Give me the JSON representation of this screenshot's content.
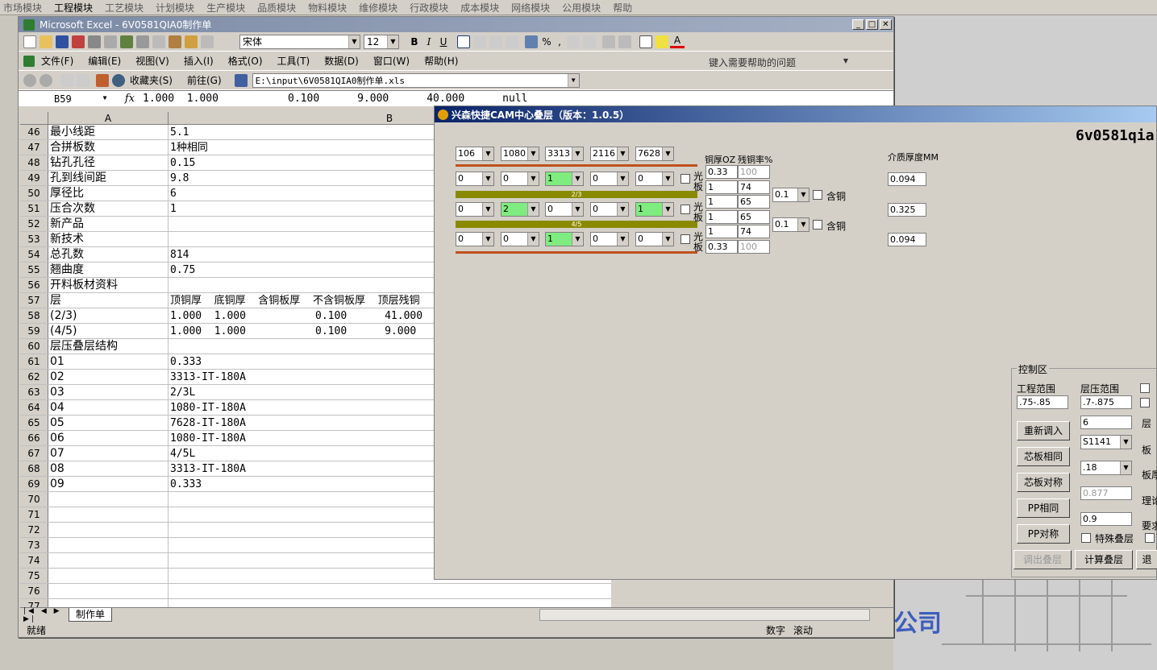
{
  "top_menu": [
    "市场模块",
    "工程模块",
    "工艺模块",
    "计划模块",
    "生产模块",
    "品质模块",
    "物料模块",
    "维修模块",
    "行政模块",
    "成本模块",
    "网络模块",
    "公用模块",
    "帮助"
  ],
  "excel": {
    "title": "Microsoft Excel - 6V0581QIA0制作单",
    "font_name": "宋体",
    "font_size": "12",
    "menu": [
      "文件(F)",
      "编辑(E)",
      "视图(V)",
      "插入(I)",
      "格式(O)",
      "工具(T)",
      "数据(D)",
      "窗口(W)",
      "帮助(H)"
    ],
    "help_placeholder": "键入需要帮助的问题",
    "web_bar": {
      "favorites": "收藏夹(S)",
      "goto": "前往(G)",
      "path": "E:\\input\\6V0581QIA0制作单.xls"
    },
    "name_box": "B59",
    "formula": "1.000  1.000           0.100      9.000      40.000      null",
    "columns": [
      "A",
      "B"
    ],
    "rows": [
      {
        "n": "46",
        "a": "最小线距",
        "b": "5.1"
      },
      {
        "n": "47",
        "a": "合拼板数",
        "b": "1种相同"
      },
      {
        "n": "48",
        "a": "钻孔孔径",
        "b": "0.15"
      },
      {
        "n": "49",
        "a": "孔到线间距",
        "b": "9.8"
      },
      {
        "n": "50",
        "a": "厚径比",
        "b": "6"
      },
      {
        "n": "51",
        "a": "压合次数",
        "b": "1"
      },
      {
        "n": "52",
        "a": "新产品",
        "b": ""
      },
      {
        "n": "53",
        "a": "新技术",
        "b": ""
      },
      {
        "n": "54",
        "a": "总孔数",
        "b": "814"
      },
      {
        "n": "55",
        "a": "翘曲度",
        "b": "0.75"
      },
      {
        "n": "56",
        "a": "开料板材资料",
        "b": ""
      },
      {
        "n": "57",
        "a": "层",
        "b": "顶铜厚  底铜厚  含铜板厚  不含铜板厚  顶层残铜"
      },
      {
        "n": "58",
        "a": "(2/3)",
        "b": "1.000  1.000           0.100      41.000"
      },
      {
        "n": "59",
        "a": "(4/5)",
        "b": "1.000  1.000           0.100      9.000"
      },
      {
        "n": "60",
        "a": "层压叠层结构",
        "b": ""
      },
      {
        "n": "61",
        "a": "01",
        "b": "0.333"
      },
      {
        "n": "62",
        "a": "02",
        "b": "3313-IT-180A"
      },
      {
        "n": "63",
        "a": "03",
        "b": "2/3L"
      },
      {
        "n": "64",
        "a": "04",
        "b": "1080-IT-180A"
      },
      {
        "n": "65",
        "a": "05",
        "b": "7628-IT-180A"
      },
      {
        "n": "66",
        "a": "06",
        "b": "1080-IT-180A"
      },
      {
        "n": "67",
        "a": "07",
        "b": "4/5L"
      },
      {
        "n": "68",
        "a": "08",
        "b": "3313-IT-180A"
      },
      {
        "n": "69",
        "a": "09",
        "b": "0.333"
      },
      {
        "n": "70",
        "a": "",
        "b": ""
      },
      {
        "n": "71",
        "a": "",
        "b": ""
      },
      {
        "n": "72",
        "a": "",
        "b": ""
      },
      {
        "n": "73",
        "a": "",
        "b": ""
      },
      {
        "n": "74",
        "a": "",
        "b": ""
      },
      {
        "n": "75",
        "a": "",
        "b": ""
      },
      {
        "n": "76",
        "a": "",
        "b": ""
      },
      {
        "n": "77",
        "a": "",
        "b": ""
      }
    ],
    "sheet_tab": "制作单",
    "status_ready": "就绪",
    "status_num": "数字",
    "status_scroll": "滚动"
  },
  "cam": {
    "title": "兴森快捷CAM中心叠层（版本：1.0.5）",
    "job": "6v0581qia",
    "pp_types": [
      "106",
      "1080",
      "3313",
      "2116",
      "7628"
    ],
    "row1": [
      "0",
      "0",
      "1",
      "0",
      "0"
    ],
    "row2": [
      "0",
      "2",
      "0",
      "0",
      "1"
    ],
    "row3": [
      "0",
      "0",
      "1",
      "0",
      "0"
    ],
    "layer_23": "2/3",
    "layer_45": "4/5",
    "guang": "光",
    "ban": "板",
    "cu_header": "铜厚OZ",
    "res_header": "残铜率%",
    "cu_vals": [
      "0.33",
      "1",
      "1",
      "1",
      "1",
      "0.33"
    ],
    "res_vals": [
      "100",
      "74",
      "65",
      "65",
      "74",
      "100"
    ],
    "core_sel": [
      "0.1",
      "0.1"
    ],
    "han_tong": "含铜",
    "dielectric_header": "介质厚度MM",
    "dielectric": [
      "0.094",
      "0.325",
      "0.094"
    ],
    "control": {
      "legend": "控制区",
      "proj_range_label": "工程范围",
      "proj_range": ".75-.85",
      "press_range_label": "层压范围",
      "press_range": ".7-.875",
      "layers": "6",
      "material": "S1141",
      "core": ".18",
      "theory": "0.877",
      "req": "0.9",
      "special": "特殊叠层",
      "buttons": [
        "重新调入",
        "芯板相同",
        "芯板对称",
        "PP相同",
        "PP对称"
      ],
      "btn_load": "调出叠层",
      "btn_calc": "计算叠层",
      "btn_exit": "退",
      "clip_labels": [
        "层",
        "板",
        "板厚",
        "理论",
        "要求"
      ]
    }
  },
  "bg_text": "公司",
  "colors": {
    "green": "#7fec7f",
    "rust": "#c0501e",
    "olive": "#8a8a00",
    "title_blue": "#0a246a"
  }
}
